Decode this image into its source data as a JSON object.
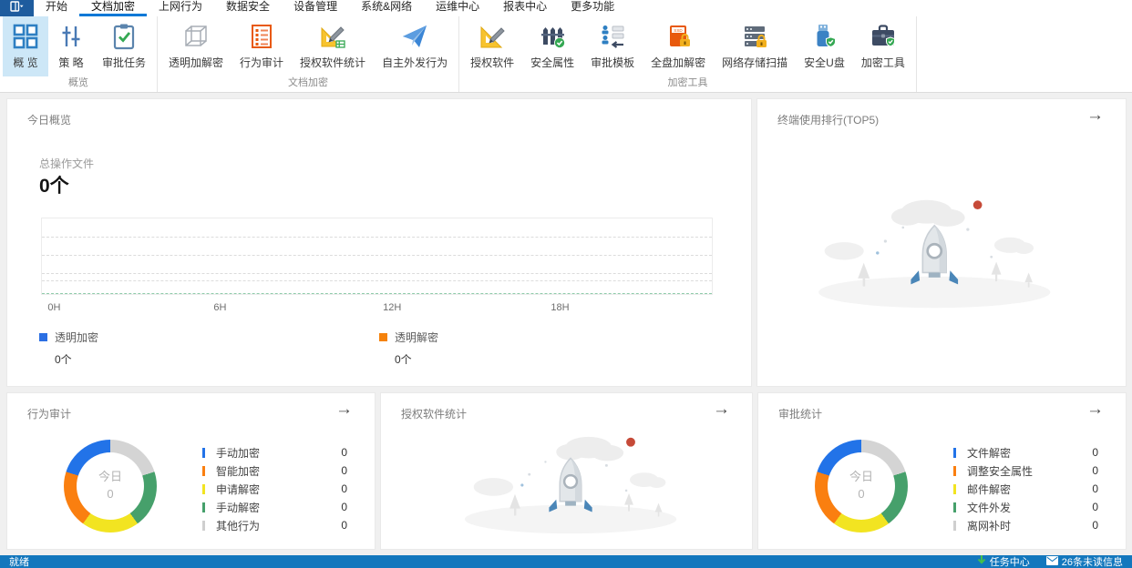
{
  "menubar": {
    "items": [
      {
        "label": "开始",
        "active": false
      },
      {
        "label": "文档加密",
        "active": true
      },
      {
        "label": "上网行为",
        "active": false
      },
      {
        "label": "数据安全",
        "active": false
      },
      {
        "label": "设备管理",
        "active": false
      },
      {
        "label": "系统&网络",
        "active": false
      },
      {
        "label": "运维中心",
        "active": false
      },
      {
        "label": "报表中心",
        "active": false
      },
      {
        "label": "更多功能",
        "active": false
      }
    ]
  },
  "ribbon": {
    "groups": [
      {
        "label": "概览",
        "items": [
          {
            "label": "概 览",
            "icon": "grid-icon",
            "selected": true
          },
          {
            "label": "策 略",
            "icon": "sliders-icon",
            "selected": false
          },
          {
            "label": "审批任务",
            "icon": "clipboard-check-icon",
            "selected": false
          }
        ]
      },
      {
        "label": "文档加密",
        "items": [
          {
            "label": "透明加解密",
            "icon": "cube-icon"
          },
          {
            "label": "行为审计",
            "icon": "list-doc-icon"
          },
          {
            "label": "授权软件统计",
            "icon": "setsquare-pencil-chart-icon"
          },
          {
            "label": "自主外发行为",
            "icon": "paper-plane-icon"
          }
        ]
      },
      {
        "label": "加密工具",
        "items": [
          {
            "label": "授权软件",
            "icon": "setsquare-pencil-icon"
          },
          {
            "label": "安全属性",
            "icon": "fence-shield-icon"
          },
          {
            "label": "审批模板",
            "icon": "org-template-icon"
          },
          {
            "label": "全盘加解密",
            "icon": "ssd-lock-icon"
          },
          {
            "label": "网络存储扫描",
            "icon": "server-lock-icon"
          },
          {
            "label": "安全U盘",
            "icon": "usb-shield-icon"
          },
          {
            "label": "加密工具",
            "icon": "briefcase-shield-icon"
          }
        ]
      }
    ]
  },
  "cards": {
    "today": {
      "title": "今日概览",
      "metric_label": "总操作文件",
      "metric_value": "0个",
      "x_ticks": [
        "0H",
        "6H",
        "12H",
        "18H"
      ],
      "legend": [
        {
          "label": "透明加密",
          "value": "0个",
          "color": "#2b6fe3"
        },
        {
          "label": "透明解密",
          "value": "0个",
          "color": "#f5820c"
        }
      ]
    },
    "terminal_rank": {
      "title": "终端使用排行(TOP5)",
      "arrow": "→"
    },
    "behavior_audit": {
      "title": "行为审计",
      "arrow": "→",
      "center_label": "今日",
      "center_value": "0",
      "legend": [
        {
          "label": "手动加密",
          "value": "0",
          "color": "#2273e8"
        },
        {
          "label": "智能加密",
          "value": "0",
          "color": "#fa7f10"
        },
        {
          "label": "申请解密",
          "value": "0",
          "color": "#f2e421"
        },
        {
          "label": "手动解密",
          "value": "0",
          "color": "#46a06b"
        },
        {
          "label": "其他行为",
          "value": "0",
          "color": "#cfcfcf"
        }
      ]
    },
    "licensed_software_stats": {
      "title": "授权软件统计",
      "arrow": "→"
    },
    "approval_stats": {
      "title": "审批统计",
      "arrow": "→",
      "center_label": "今日",
      "center_value": "0",
      "legend": [
        {
          "label": "文件解密",
          "value": "0",
          "color": "#2273e8"
        },
        {
          "label": "调整安全属性",
          "value": "0",
          "color": "#fa7f10"
        },
        {
          "label": "邮件解密",
          "value": "0",
          "color": "#f2e421"
        },
        {
          "label": "文件外发",
          "value": "0",
          "color": "#46a06b"
        },
        {
          "label": "离网补时",
          "value": "0",
          "color": "#cfcfcf"
        }
      ]
    }
  },
  "chart_data": [
    {
      "type": "line",
      "title": "今日概览",
      "x_ticks": [
        "0H",
        "6H",
        "12H",
        "18H"
      ],
      "x_range": "0H-24H",
      "series": [
        {
          "name": "透明加密",
          "color": "#2b6fe3",
          "total": "0个",
          "values": []
        },
        {
          "name": "透明解密",
          "color": "#f5820c",
          "total": "0个",
          "values": []
        }
      ],
      "legend_position": "below",
      "note": "empty plot: dashed gray gridlines, dashed green baseline, no data plotted"
    },
    {
      "type": "pie",
      "title": "行为审计",
      "categories": [
        "手动加密",
        "智能加密",
        "申请解密",
        "手动解密",
        "其他行为"
      ],
      "values": [
        0,
        0,
        0,
        0,
        0
      ],
      "center_label": "今日",
      "center_value": 0,
      "colors": [
        "#2273e8",
        "#fa7f10",
        "#f2e421",
        "#46a06b",
        "#d4d4d4"
      ],
      "display": "donut placeholder ring of 5 equal segments (gray,green,yellow,orange,blue clockwise from top)"
    },
    {
      "type": "pie",
      "title": "审批统计",
      "categories": [
        "文件解密",
        "调整安全属性",
        "邮件解密",
        "文件外发",
        "离网补时"
      ],
      "values": [
        0,
        0,
        0,
        0,
        0
      ],
      "center_label": "今日",
      "center_value": 0,
      "colors": [
        "#2273e8",
        "#fa7f10",
        "#f2e421",
        "#46a06b",
        "#d4d4d4"
      ],
      "display": "donut placeholder ring of 5 equal segments (gray,green,yellow,orange,blue clockwise from top)"
    }
  ],
  "statusbar": {
    "ready": "就绪",
    "task_center": "任务中心",
    "unread": "26条未读信息"
  },
  "colors": {
    "accent": "#0078d7",
    "statusbar_bg": "#1377bd",
    "ribbon_selected_bg": "#cde7f7",
    "content_bg": "#f0f0f0",
    "app_button_bg": "#1e5c9e"
  }
}
